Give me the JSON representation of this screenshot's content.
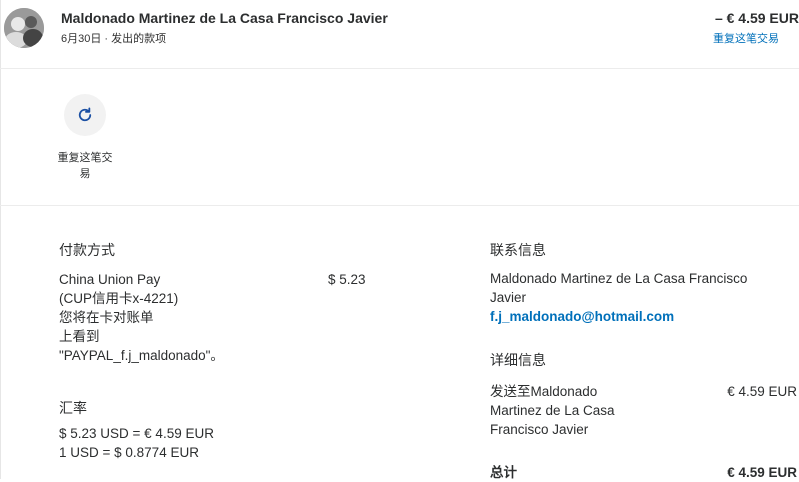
{
  "header": {
    "merchant_name": "Maldonado Martinez de La Casa Francisco Javier",
    "date": "6月30日",
    "separator": "·",
    "type": "发出的款项",
    "amount": "– € 4.59 EUR",
    "repeat_link": "重复这笔交易"
  },
  "actions": {
    "repeat_label_line1": "重复这笔交",
    "repeat_label_line2": "易"
  },
  "payment_method": {
    "title": "付款方式",
    "line1": "China Union Pay",
    "line2": "(CUP信用卡x-4221)",
    "line3": "您将在卡对账单",
    "line4": "上看到",
    "line5": "\"PAYPAL_f.j_maldonado\"。",
    "amount": "$ 5.23"
  },
  "exchange": {
    "title": "汇率",
    "line1": "$ 5.23 USD = € 4.59 EUR",
    "line2": "1 USD = $ 0.8774 EUR"
  },
  "contact": {
    "title": "联系信息",
    "name_line1": "Maldonado Martinez de La Casa Francisco",
    "name_line2": "Javier",
    "email": "f.j_maldonado@hotmail.com"
  },
  "details": {
    "title": "详细信息",
    "sent_line1": "发送至Maldonado",
    "sent_line2": "Martinez de La Casa",
    "sent_line3": "Francisco Javier",
    "sent_amount": "€ 4.59 EUR",
    "total_label": "总计",
    "total_amount": "€ 4.59 EUR"
  },
  "colors": {
    "link": "#0070ba",
    "text": "#2c2e2f",
    "action_bg": "#f2f2f2"
  },
  "icons": {
    "avatar": "user-avatar",
    "repeat": "refresh-icon"
  }
}
